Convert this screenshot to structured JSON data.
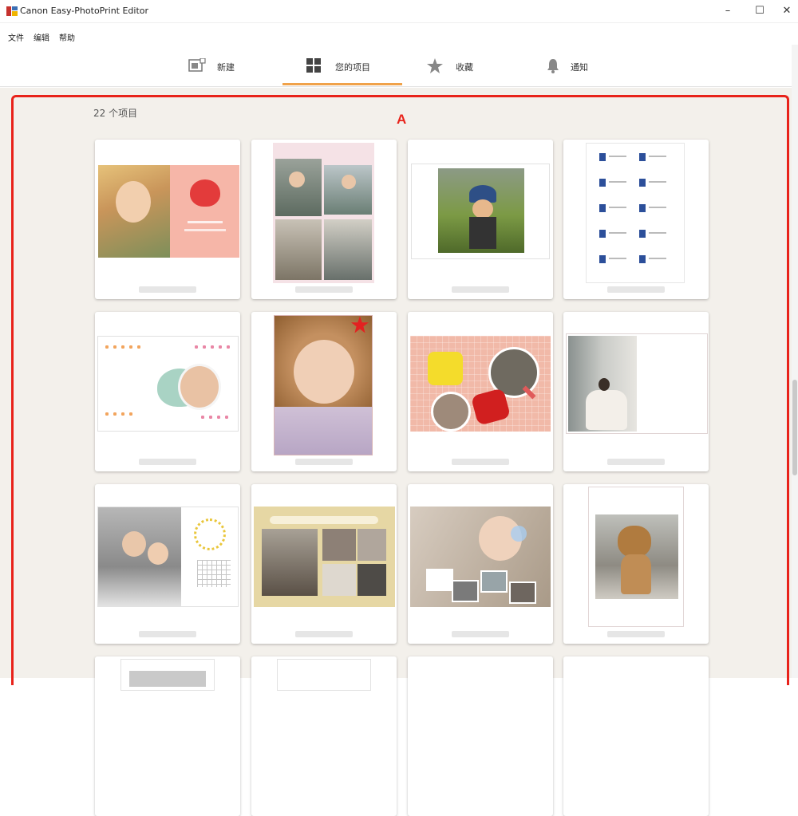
{
  "window": {
    "title": "Canon Easy-PhotoPrint Editor",
    "minimize": "–",
    "maximize": "☐",
    "close": "✕"
  },
  "menu": {
    "items": [
      "文件",
      "编辑",
      "帮助"
    ]
  },
  "tabs": [
    {
      "label": "新建",
      "icon": "new-icon"
    },
    {
      "label": "您的项目",
      "icon": "grid-icon",
      "selected": true
    },
    {
      "label": "收藏",
      "icon": "star-icon"
    },
    {
      "label": "通知",
      "icon": "bell-icon"
    }
  ],
  "content": {
    "count": "22 个项目",
    "marker": "A"
  },
  "colors": {
    "accent": "#f0a24a",
    "highlight": "#e8221a",
    "background": "#f3f0eb"
  }
}
